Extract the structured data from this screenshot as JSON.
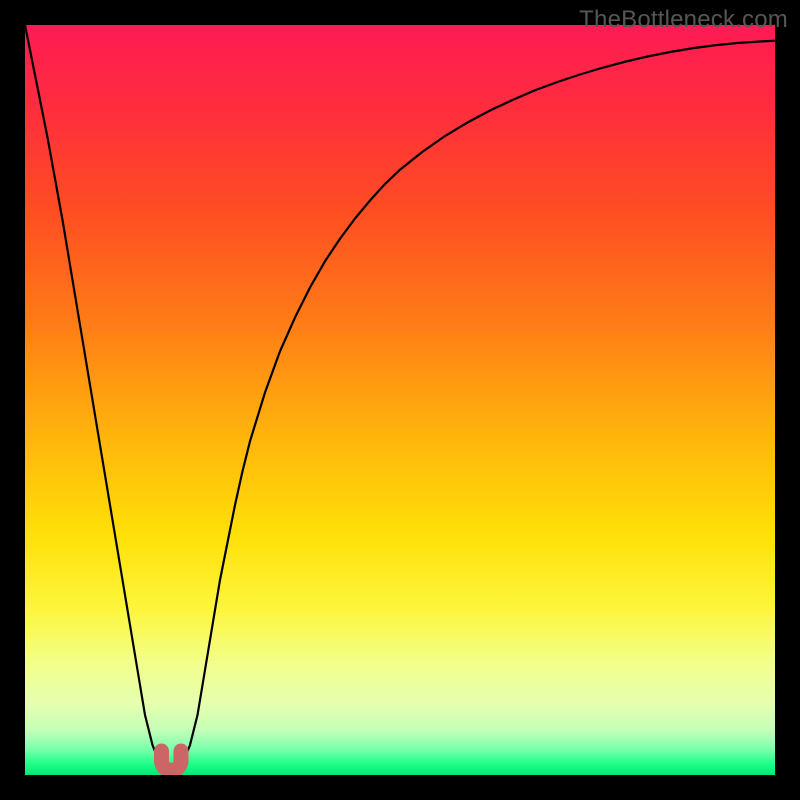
{
  "watermark": "TheBottleneck.com",
  "colors": {
    "frame": "#000000",
    "curve_stroke": "#000000",
    "marker_fill": "#cc6666",
    "marker_stroke": "#a04848",
    "gradient_stops": [
      {
        "offset": 0.0,
        "color": "#ff1a54"
      },
      {
        "offset": 0.12,
        "color": "#ff2f3b"
      },
      {
        "offset": 0.25,
        "color": "#ff4e22"
      },
      {
        "offset": 0.4,
        "color": "#ff7d16"
      },
      {
        "offset": 0.55,
        "color": "#ffb50c"
      },
      {
        "offset": 0.68,
        "color": "#ffe008"
      },
      {
        "offset": 0.78,
        "color": "#fdf63e"
      },
      {
        "offset": 0.85,
        "color": "#f2ff8a"
      },
      {
        "offset": 0.905,
        "color": "#e6ffb0"
      },
      {
        "offset": 0.94,
        "color": "#c4ffb8"
      },
      {
        "offset": 0.965,
        "color": "#7dffad"
      },
      {
        "offset": 0.985,
        "color": "#1eff88"
      },
      {
        "offset": 1.0,
        "color": "#08e573"
      }
    ]
  },
  "chart_data": {
    "type": "line",
    "title": "",
    "xlabel": "",
    "ylabel": "",
    "xlim": [
      0,
      100
    ],
    "ylim": [
      0,
      100
    ],
    "x": [
      0,
      1,
      2,
      3,
      4,
      5,
      6,
      7,
      8,
      9,
      10,
      11,
      12,
      13,
      14,
      15,
      16,
      17,
      18,
      19,
      20,
      21,
      22,
      23,
      24,
      25,
      26,
      27,
      28,
      29,
      30,
      32,
      34,
      36,
      38,
      40,
      42,
      44,
      46,
      48,
      50,
      53,
      56,
      59,
      62,
      65,
      68,
      71,
      74,
      77,
      80,
      83,
      86,
      89,
      92,
      95,
      98,
      100
    ],
    "values": [
      100,
      95,
      90,
      85,
      79.5,
      74,
      68,
      62,
      56,
      50,
      44,
      38,
      32,
      26,
      20,
      14,
      8,
      4,
      1.5,
      0.5,
      0.5,
      1.5,
      4,
      8,
      14,
      20,
      26,
      31,
      36,
      40.5,
      44.5,
      51,
      56.5,
      61,
      65,
      68.5,
      71.5,
      74.2,
      76.6,
      78.8,
      80.7,
      83.1,
      85.2,
      87,
      88.6,
      90,
      91.3,
      92.4,
      93.4,
      94.3,
      95.1,
      95.8,
      96.4,
      96.9,
      97.3,
      97.6,
      97.8,
      97.9
    ],
    "marker": {
      "x_range": [
        18.2,
        20.8
      ],
      "y": 0.5
    }
  }
}
